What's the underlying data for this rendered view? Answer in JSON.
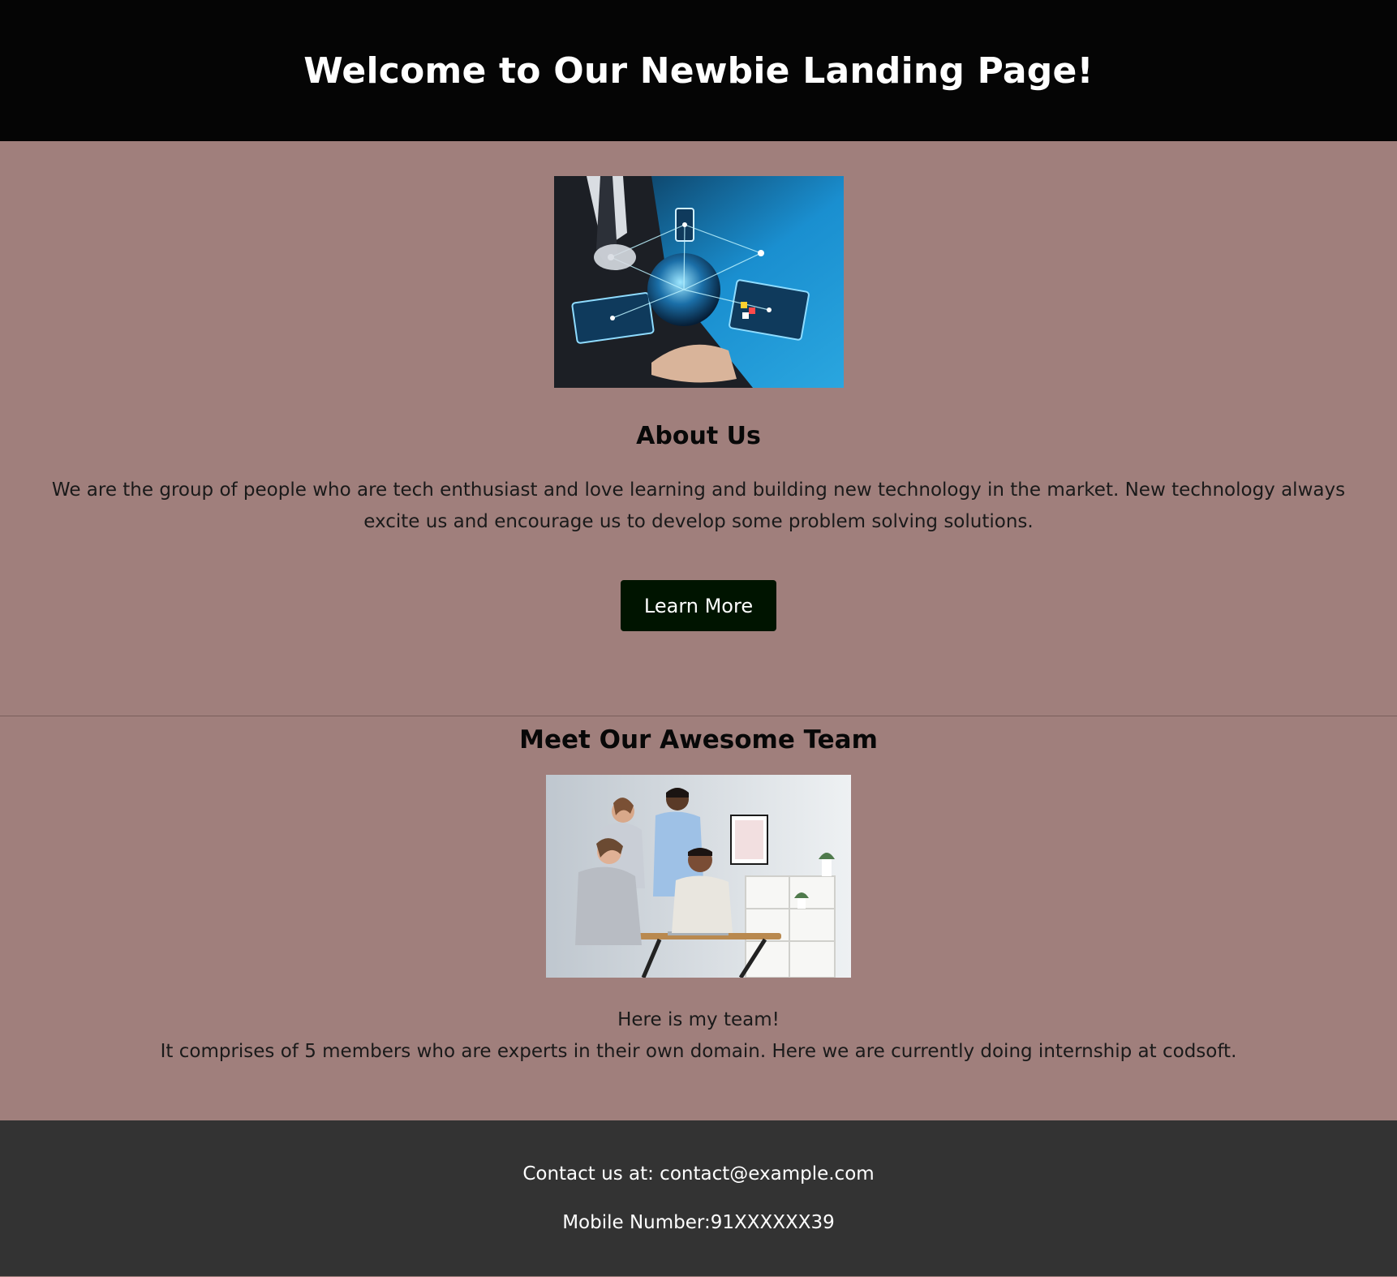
{
  "header": {
    "title": "Welcome to Our Newbie Landing Page!"
  },
  "about": {
    "image": "technology-globe-image",
    "heading": "About Us",
    "paragraph": "We are the group of people who are tech enthusiast and love learning and building new technology in the market. New technology always excite us and encourage us to develop some problem solving solutions.",
    "button_label": "Learn More"
  },
  "team": {
    "heading": "Meet Our Awesome Team",
    "image": "team-office-image",
    "line1": "Here is my team!",
    "line2": "It comprises of 5 members who are experts in their own domain. Here we are currently doing internship at codsoft."
  },
  "footer": {
    "contact": "Contact us at: contact@example.com",
    "mobile": "Mobile Number:91XXXXXX39"
  },
  "colors": {
    "header_bg": "#050505",
    "page_bg": "#a07f7c",
    "button_bg": "#001400",
    "footer_bg": "#333333"
  }
}
